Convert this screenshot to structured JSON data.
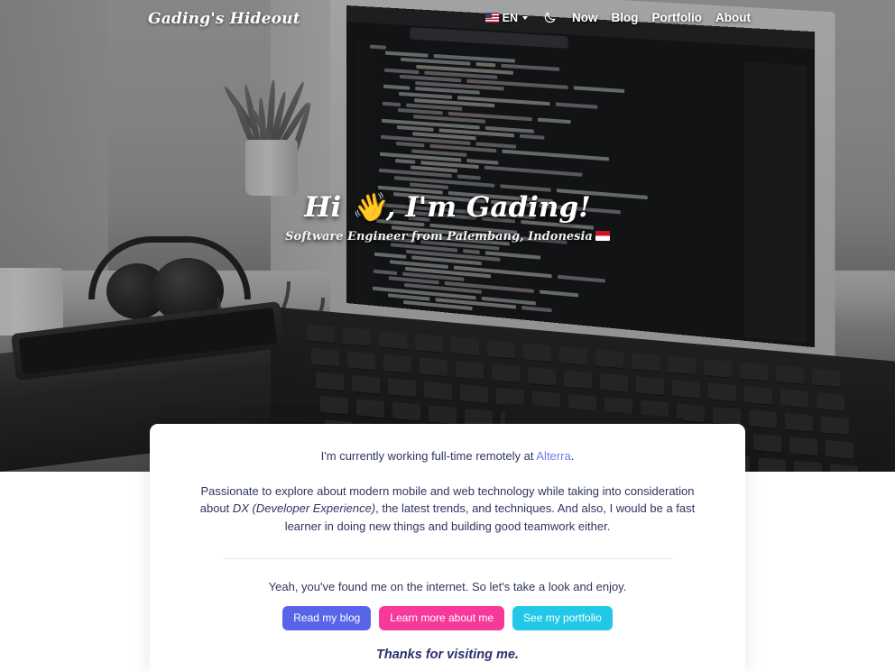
{
  "site": {
    "brand": "Gading's Hideout"
  },
  "nav": {
    "language": {
      "flag_icon": "us-flag-icon",
      "code": "EN",
      "caret_icon": "chevron-down-icon"
    },
    "theme_toggle_icon": "moon-icon",
    "links": [
      {
        "label": "Now"
      },
      {
        "label": "Blog"
      },
      {
        "label": "Portfolio"
      },
      {
        "label": "About"
      }
    ]
  },
  "hero": {
    "title": "Hi 👋, I'm Gading!",
    "subtitle_text": "Software Engineer from Palembang, Indonesia",
    "subtitle_flag_icon": "indonesia-flag-icon"
  },
  "card": {
    "status_prefix": "I'm currently working full-time remotely at ",
    "status_company": "Alterra",
    "status_suffix": ".",
    "bio_part1": "Passionate to explore about modern mobile and web technology while taking into consideration about ",
    "bio_emphasis": "DX (Developer Experience)",
    "bio_part2": ", the latest trends, and techniques. And also, I would be a fast learner in doing new things and building good teamwork either.",
    "closing": "Yeah, you've found me on the internet. So let's take a look and enjoy.",
    "buttons": [
      {
        "label": "Read my blog",
        "color": "#5865e8"
      },
      {
        "label": "Learn more about me",
        "color": "#f6399a"
      },
      {
        "label": "See my portfolio",
        "color": "#22c8e8"
      }
    ],
    "thanks": "Thanks for visiting me."
  },
  "colors": {
    "text": "#2f3560",
    "link": "#6b7ce8",
    "thanks": "#2c2f6b",
    "divider": "#e9e9ee"
  }
}
